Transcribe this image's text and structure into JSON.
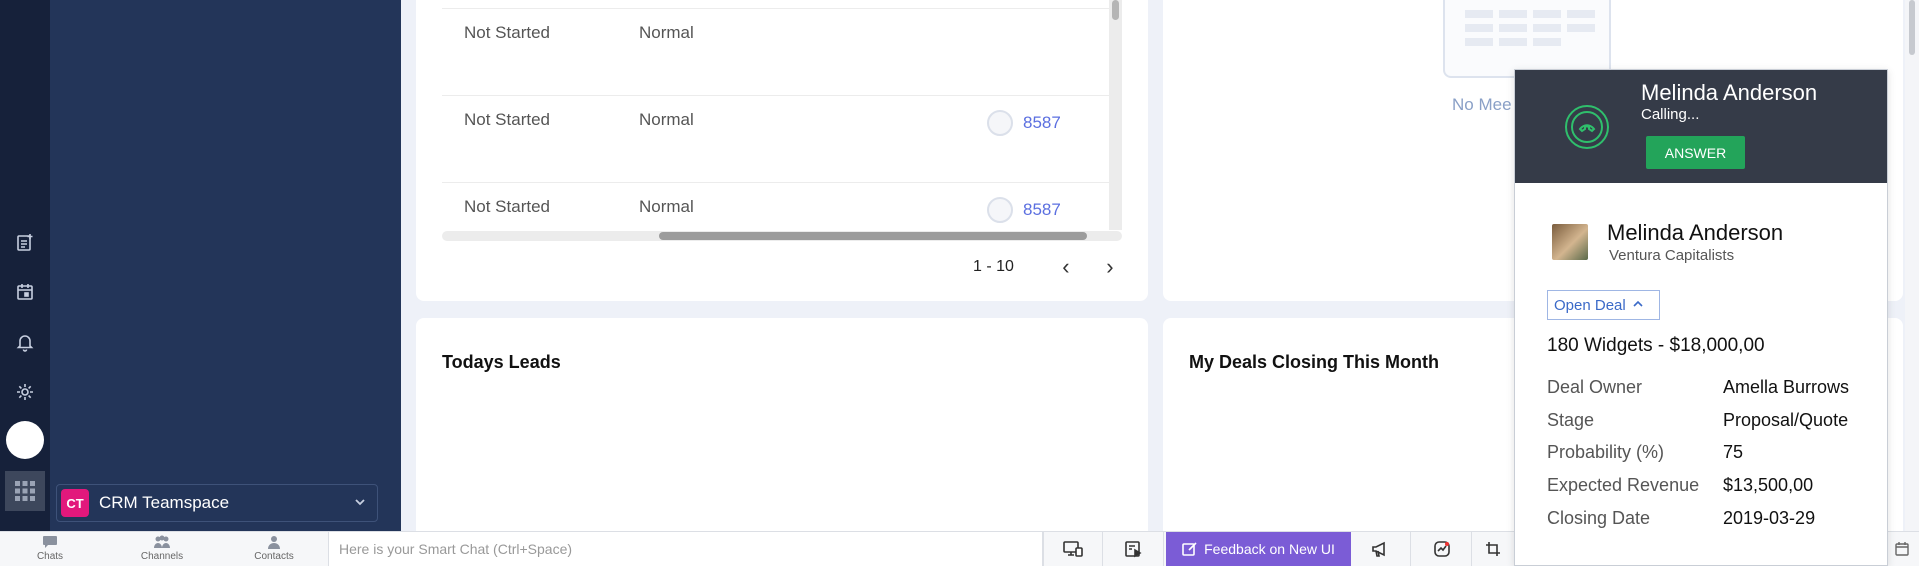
{
  "teamspace": {
    "badge": "CT",
    "label": "CRM Teamspace"
  },
  "tasks": {
    "rows": [
      {
        "status": "Not Started",
        "priority": "Normal",
        "owner": ""
      },
      {
        "status": "Not Started",
        "priority": "Normal",
        "owner": "8587"
      },
      {
        "status": "Not Started",
        "priority": "Normal",
        "owner": "8587"
      }
    ],
    "pagination": "1 - 10"
  },
  "meetings": {
    "empty_text": "No Mee"
  },
  "leads": {
    "title": "Todays Leads"
  },
  "deals": {
    "title": "My Deals Closing This Month"
  },
  "bottombar": {
    "chats": "Chats",
    "channels": "Channels",
    "contacts": "Contacts",
    "smartchat_placeholder": "Here is your Smart Chat (Ctrl+Space)",
    "feedback": "Feedback on New UI"
  },
  "call": {
    "caller_name": "Melinda Anderson",
    "status": "Calling...",
    "answer_label": "ANSWER",
    "contact_name": "Melinda Anderson",
    "company": "Ventura Capitalists",
    "open_deal_label": "Open Deal",
    "deal_title": "180 Widgets - $18,000,00",
    "details": [
      {
        "label": "Deal Owner",
        "value": "Amella Burrows"
      },
      {
        "label": "Stage",
        "value": "Proposal/Quote"
      },
      {
        "label": "Probability (%)",
        "value": "75"
      },
      {
        "label": "Expected Revenue",
        "value": "$13,500,00"
      },
      {
        "label": "Closing Date",
        "value": "2019-03-29"
      }
    ]
  },
  "colors": {
    "rail": "#16213a",
    "panel": "#233559",
    "accent_green": "#23a45a",
    "feedback": "#7b5cd6"
  }
}
